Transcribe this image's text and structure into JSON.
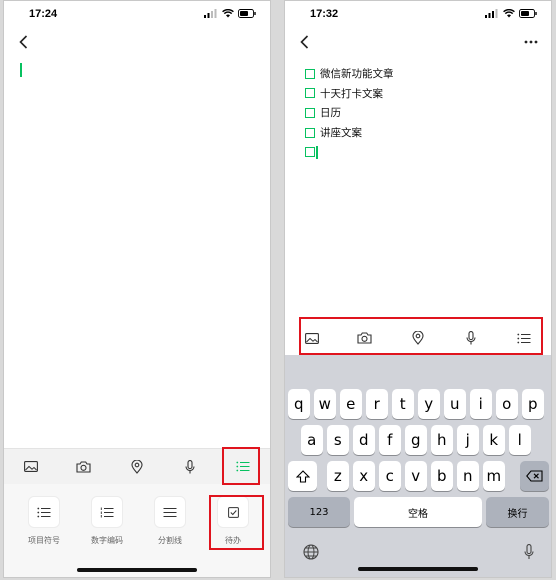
{
  "left_screen": {
    "time": "17:24",
    "toolbar_icons": [
      "image-icon",
      "camera-icon",
      "location-icon",
      "microphone-icon",
      "list-icon"
    ],
    "format_options": [
      {
        "label": "项目符号",
        "icon": "bullet-list-icon"
      },
      {
        "label": "数字编码",
        "icon": "numbered-list-icon"
      },
      {
        "label": "分割线",
        "icon": "divider-icon"
      },
      {
        "label": "待办",
        "icon": "checkbox-icon"
      }
    ]
  },
  "right_screen": {
    "time": "17:32",
    "todos": [
      "微信新功能文章",
      "十天打卡文案",
      "日历",
      "讲座文案",
      ""
    ],
    "toolbar_icons": [
      "image-icon",
      "camera-icon",
      "location-icon",
      "microphone-icon",
      "list-icon"
    ],
    "keyboard": {
      "row1": [
        "q",
        "w",
        "e",
        "r",
        "t",
        "y",
        "u",
        "i",
        "o",
        "p"
      ],
      "row2": [
        "a",
        "s",
        "d",
        "f",
        "g",
        "h",
        "j",
        "k",
        "l"
      ],
      "row3": [
        "z",
        "x",
        "c",
        "v",
        "b",
        "n",
        "m"
      ],
      "numbers_key": "123",
      "space_key": "空格",
      "return_key": "换行"
    }
  },
  "colors": {
    "accent_green": "#07c160",
    "highlight_red": "#e0141e",
    "keyboard_bg": "#d1d3d9"
  }
}
